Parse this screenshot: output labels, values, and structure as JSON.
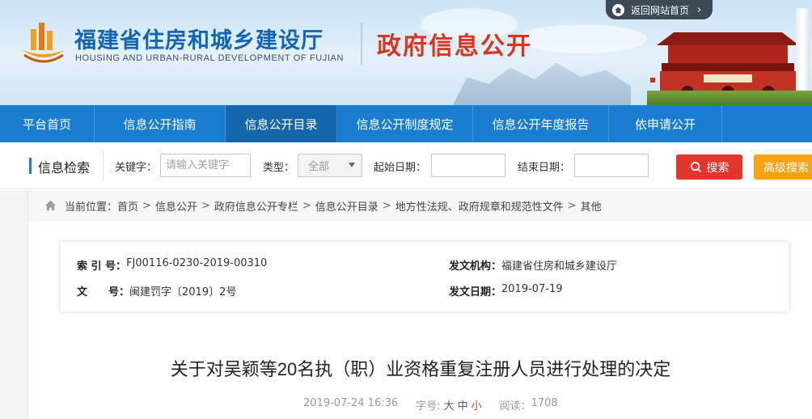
{
  "header": {
    "title_cn": "福建省住房和城乡建设厅",
    "title_en": "HOUSING AND URBAN-RURAL DEVELOPMENT OF FUJIAN",
    "section": "政府信息公开",
    "back_link": "返回网站首页"
  },
  "nav": {
    "items": [
      {
        "label": "平台首页"
      },
      {
        "label": "信息公开指南"
      },
      {
        "label": "信息公开目录"
      },
      {
        "label": "信息公开制度规定"
      },
      {
        "label": "信息公开年度报告"
      },
      {
        "label": "依申请公开"
      }
    ],
    "active_index": 2
  },
  "search": {
    "title": "信息检索",
    "keyword_label": "关键字：",
    "keyword_placeholder": "请输入关键字",
    "type_label": "类型：",
    "type_value": "全部",
    "start_label": "起始日期：",
    "end_label": "结束日期：",
    "search_button": "搜索",
    "advanced_button": "高级搜索"
  },
  "breadcrumb": {
    "prefix": "当前位置：",
    "items": [
      "首页",
      "信息公开",
      "政府信息公开专栏",
      "信息公开目录",
      "地方性法规、政府规章和规范性文件",
      "其他"
    ]
  },
  "meta": {
    "index_key": "索 引 号：",
    "index_value": "FJ00116-0230-2019-00310",
    "org_key": "发文机构：",
    "org_value": "福建省住房和城乡建设厅",
    "doc_key": "文　　号：",
    "doc_value": "闽建罚字〔2019〕2号",
    "date_key": "发文日期：",
    "date_value": "2019-07-19"
  },
  "document": {
    "title": "关于对吴颖等20名执（职）业资格重复注册人员进行处理的决定",
    "published": "2019-07-24 16:36",
    "font_label": "字号:",
    "font_large": "大",
    "font_medium": "中",
    "font_small": "小",
    "views_label": "阅读：",
    "views": "1708"
  },
  "colors": {
    "nav": "#1a7ed0",
    "nav_active": "#1566ab",
    "brand_blue": "#1465b1",
    "brand_red": "#d8361f",
    "search_btn": "#e0362c",
    "advanced_btn": "#f5a214"
  }
}
